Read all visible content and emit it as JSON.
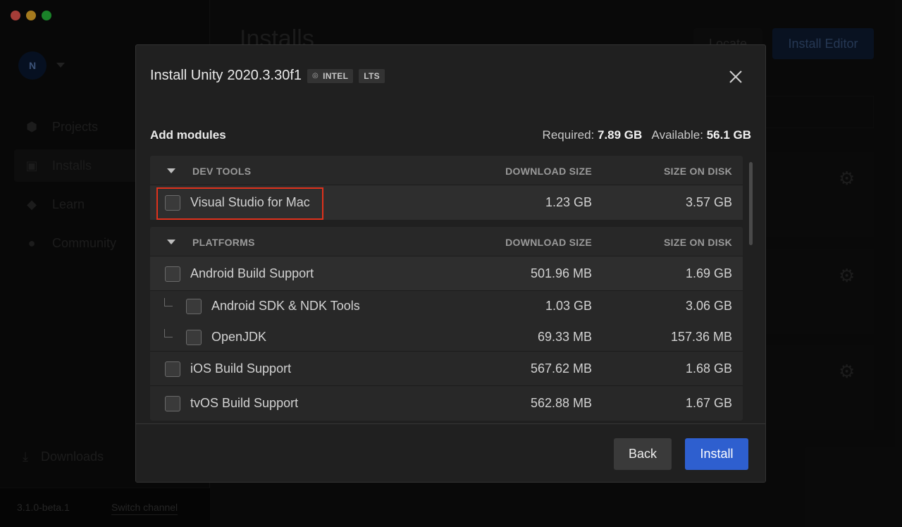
{
  "app": {
    "avatar_initial": "N",
    "nav": [
      {
        "label": "Projects",
        "icon": "cube-icon"
      },
      {
        "label": "Installs",
        "icon": "lock-icon"
      },
      {
        "label": "Learn",
        "icon": "graduation-cap-icon"
      },
      {
        "label": "Community",
        "icon": "people-icon"
      }
    ],
    "downloads_label": "Downloads",
    "version": "3.1.0-beta.1",
    "switch_channel": "Switch channel",
    "page_title": "Installs",
    "locate_label": "Locate",
    "install_editor_label": "Install Editor"
  },
  "modal": {
    "title_prefix": "Install Unity",
    "version": "2020.3.30f1",
    "badges": [
      "INTEL",
      "LTS"
    ],
    "add_modules": "Add modules",
    "required_label": "Required:",
    "required_value": "7.89 GB",
    "available_label": "Available:",
    "available_value": "56.1 GB",
    "sections": [
      {
        "name": "DEV TOOLS",
        "col_download": "DOWNLOAD SIZE",
        "col_disk": "SIZE ON DISK",
        "rows": [
          {
            "label": "Visual Studio for Mac",
            "download": "1.23 GB",
            "disk": "3.57 GB",
            "checked": false
          }
        ]
      },
      {
        "name": "PLATFORMS",
        "col_download": "DOWNLOAD SIZE",
        "col_disk": "SIZE ON DISK",
        "rows": [
          {
            "label": "Android Build Support",
            "download": "501.96 MB",
            "disk": "1.69 GB",
            "checked": false
          },
          {
            "label": "Android SDK & NDK Tools",
            "download": "1.03 GB",
            "disk": "3.06 GB",
            "checked": false,
            "sub": true
          },
          {
            "label": "OpenJDK",
            "download": "69.33 MB",
            "disk": "157.36 MB",
            "checked": false,
            "sub": true
          },
          {
            "label": "iOS Build Support",
            "download": "567.62 MB",
            "disk": "1.68 GB",
            "checked": false
          },
          {
            "label": "tvOS Build Support",
            "download": "562.88 MB",
            "disk": "1.67 GB",
            "checked": false
          }
        ]
      }
    ],
    "back_label": "Back",
    "install_label": "Install"
  },
  "colors": {
    "accent": "#2e5fcf",
    "highlight": "#e0321c"
  }
}
